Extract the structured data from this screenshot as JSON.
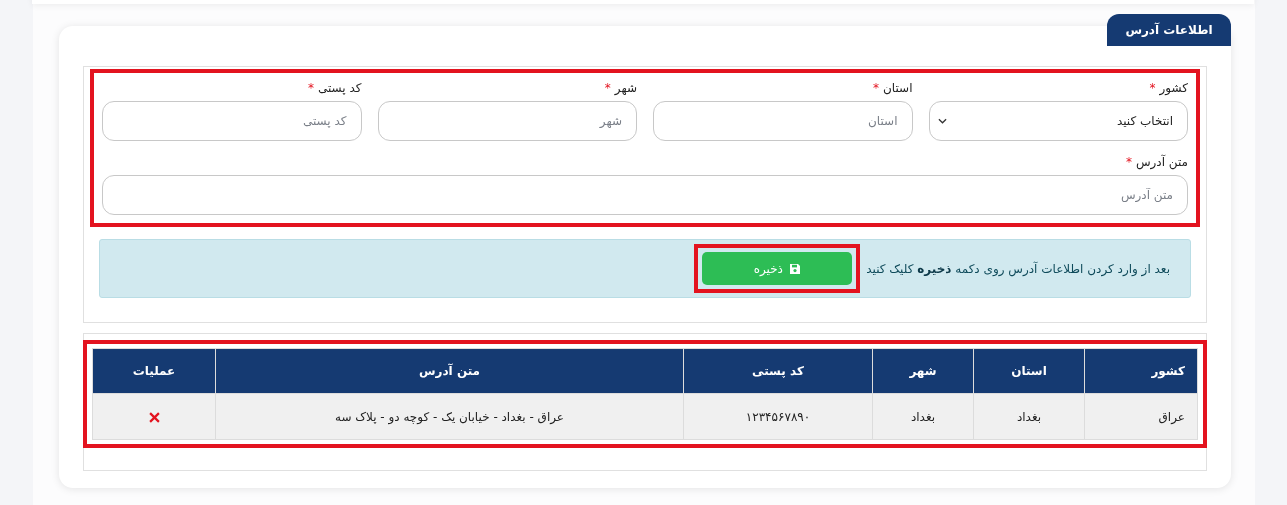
{
  "tab": {
    "label": "اطلاعات آدرس",
    "selected": true
  },
  "form": {
    "highlighted": true,
    "fields": [
      {
        "kind": "select",
        "label": "کشور",
        "required_mark": "*",
        "value": "انتخاب کنید"
      },
      {
        "kind": "text",
        "label": "استان",
        "required_mark": "*",
        "placeholder": "استان"
      },
      {
        "kind": "text",
        "label": "شهر",
        "required_mark": "*",
        "placeholder": "شهر"
      },
      {
        "kind": "text",
        "label": "کد پستی",
        "required_mark": "*",
        "placeholder": "کد پستی"
      },
      {
        "kind": "wide_text",
        "label": "متن آدرس",
        "required_mark": "*",
        "placeholder": "متن آدرس"
      }
    ]
  },
  "notice": {
    "text": "بعد از وارد کردن اطلاعات آدرس روی دکمه **ذخیره** کلیک کنید",
    "button": {
      "label": "ذخیره",
      "highlighted": true
    }
  },
  "table": {
    "highlighted": true,
    "columns": [
      "کشور",
      "استان",
      "شهر",
      "کد پستی",
      "متن آدرس",
      "عملیات"
    ],
    "rows": [
      {
        "cells": [
          "عراق",
          "بغداد",
          "بغداد",
          "١٢٣۴۵۶٧٨٩٠",
          "عراق - بغداد - خیابان یک - کوچه دو - پلاک سه"
        ],
        "deletable": true
      }
    ]
  }
}
